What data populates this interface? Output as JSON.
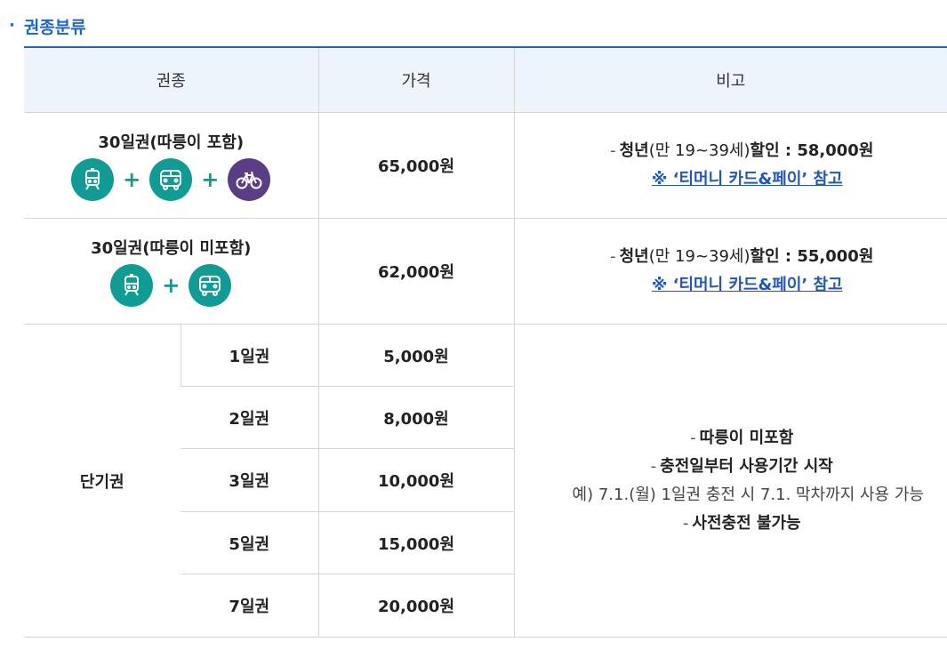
{
  "section": {
    "bullet": "·",
    "title": "권종분류"
  },
  "headers": {
    "type": "권종",
    "price": "가격",
    "remarks": "비고"
  },
  "passes": [
    {
      "name": "30일권(따릉이 포함)",
      "price": "65,000원",
      "remark_dash": "-",
      "remark_bold1": "청년",
      "remark_normal": "(만 19~39세)",
      "remark_bold2": "할인 : 58,000원",
      "link": "※ ‘티머니 카드&페이’ 참고",
      "icons": [
        "subway-icon",
        "bus-icon",
        "bicycle-icon"
      ],
      "plus": "+"
    },
    {
      "name": "30일권(따릉이 미포함)",
      "price": "62,000원",
      "remark_dash": "-",
      "remark_bold1": "청년",
      "remark_normal": "(만 19~39세)",
      "remark_bold2": "할인 : 55,000원",
      "link": "※ ‘티머니 카드&페이’ 참고",
      "icons": [
        "subway-icon",
        "bus-icon"
      ],
      "plus": "+"
    }
  ],
  "short_term": {
    "label": "단기권",
    "rows": [
      {
        "name": "1일권",
        "price": "5,000원"
      },
      {
        "name": "2일권",
        "price": "8,000원"
      },
      {
        "name": "3일권",
        "price": "10,000원"
      },
      {
        "name": "5일권",
        "price": "15,000원"
      },
      {
        "name": "7일권",
        "price": "20,000원"
      }
    ],
    "notes": {
      "dash": "-",
      "n1": "따릉이 미포함",
      "n2": "충전일부터 사용기간 시작",
      "n2_example": "예) 7.1.(월) 1일권 충전 시 7.1. 막차까지 사용 가능",
      "n3": "사전충전 불가능"
    }
  },
  "colors": {
    "accent": "#1f66c7",
    "teal": "#0e9c95",
    "purple": "#5b3d85",
    "header_bg": "#eef4fb",
    "link": "#2255c4"
  }
}
